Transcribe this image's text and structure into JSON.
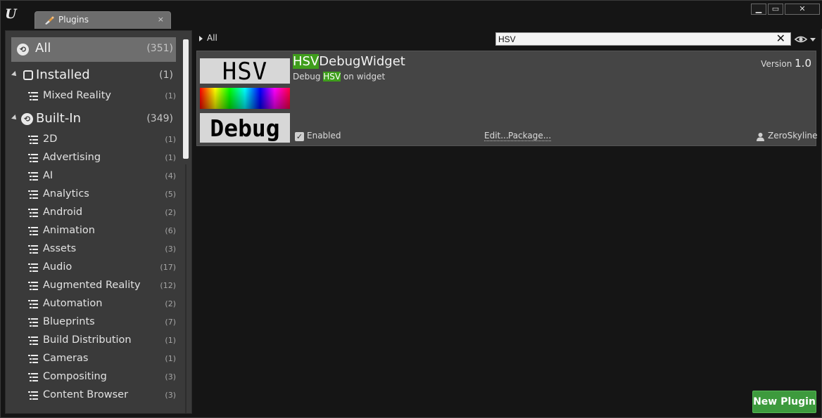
{
  "window": {
    "tab_title": "Plugins",
    "tab_close": "×",
    "buttons": {
      "minimize": "▁",
      "maximize": "▭",
      "close": "✕"
    },
    "logo": "U"
  },
  "sidebar": {
    "all": {
      "label": "All",
      "count": "(351)"
    },
    "installed": {
      "label": "Installed",
      "count": "(1)",
      "items": [
        {
          "label": "Mixed Reality",
          "count": "(1)"
        }
      ]
    },
    "builtin": {
      "label": "Built-In",
      "count": "(349)",
      "items": [
        {
          "label": "2D",
          "count": "(1)"
        },
        {
          "label": "Advertising",
          "count": "(1)"
        },
        {
          "label": "AI",
          "count": "(4)"
        },
        {
          "label": "Analytics",
          "count": "(5)"
        },
        {
          "label": "Android",
          "count": "(2)"
        },
        {
          "label": "Animation",
          "count": "(6)"
        },
        {
          "label": "Assets",
          "count": "(3)"
        },
        {
          "label": "Audio",
          "count": "(17)"
        },
        {
          "label": "Augmented Reality",
          "count": "(12)"
        },
        {
          "label": "Automation",
          "count": "(2)"
        },
        {
          "label": "Blueprints",
          "count": "(7)"
        },
        {
          "label": "Build Distribution",
          "count": "(1)"
        },
        {
          "label": "Cameras",
          "count": "(1)"
        },
        {
          "label": "Compositing",
          "count": "(3)"
        },
        {
          "label": "Content Browser",
          "count": "(3)"
        }
      ]
    }
  },
  "main": {
    "breadcrumb": "All",
    "search": {
      "value": "HSV",
      "clear": "✕"
    },
    "plugin": {
      "thumb_top": "HSV",
      "thumb_bottom": "Debug",
      "title_highlight": "HSV",
      "title_rest": "DebugWidget",
      "desc_pre": "Debug ",
      "desc_highlight": "HSV",
      "desc_post": " on widget",
      "version_label": "Version",
      "version_number": "1.0",
      "enabled_label": "Enabled",
      "edit_label": "Edit...",
      "package_label": "Package...",
      "author": "ZeroSkyline"
    },
    "new_plugin_label": "New Plugin"
  }
}
